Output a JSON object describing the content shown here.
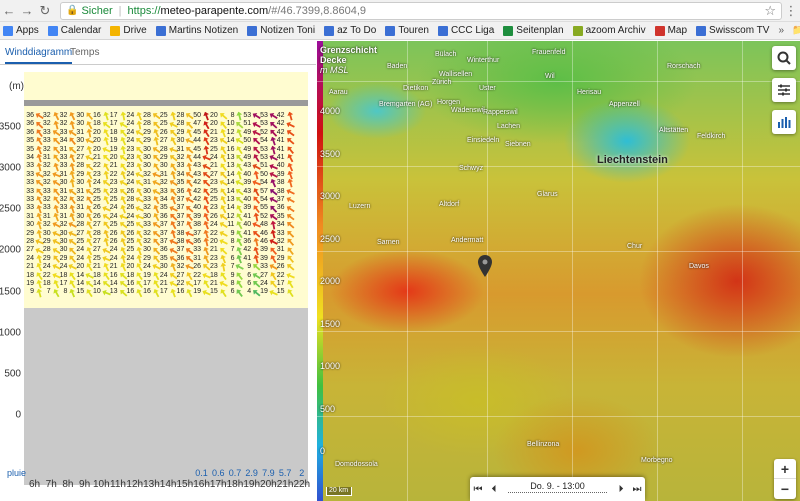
{
  "browser": {
    "secure_label": "Sicher",
    "url_scheme": "https://",
    "url_host": "meteo-parapente.com",
    "url_rest": "/#/46.7399,8.8604,9"
  },
  "bookmarks": [
    {
      "label": "Apps",
      "color": "#4285f4"
    },
    {
      "label": "Calendar",
      "color": "#4285f4"
    },
    {
      "label": "Drive",
      "color": "#f4b400"
    },
    {
      "label": "Martins Notizen",
      "color": "#3b6fd4"
    },
    {
      "label": "Notizen Toni",
      "color": "#3b6fd4"
    },
    {
      "label": "az To Do",
      "color": "#3b6fd4"
    },
    {
      "label": "Touren",
      "color": "#3b6fd4"
    },
    {
      "label": "CCC Liga",
      "color": "#3b6fd4"
    },
    {
      "label": "Seitenplan",
      "color": "#1e8e3e"
    },
    {
      "label": "azoom Archiv",
      "color": "#88aa22"
    },
    {
      "label": "Map",
      "color": "#d0342c"
    },
    {
      "label": "Swisscom TV",
      "color": "#3b6fd4"
    }
  ],
  "bookmarks_more": "»",
  "bookmarks_other": "Andere Lesezeichen",
  "tabs": {
    "active": "Winddiagramm",
    "inactive": "Temps"
  },
  "diagram": {
    "unit": "(m)",
    "yticks": [
      "3500",
      "3000",
      "2500",
      "2000",
      "1500",
      "1000",
      "500",
      "0"
    ],
    "hours": [
      "6h",
      "7h",
      "8h",
      "9h",
      "10h",
      "11h",
      "12h",
      "13h",
      "14h",
      "15h",
      "16h",
      "17h",
      "18h",
      "19h",
      "20h",
      "21h",
      "22h"
    ],
    "precip_label": "pluie",
    "precip": [
      "",
      "",
      "",
      "",
      "",
      "",
      "",
      "",
      "",
      "",
      "0.1",
      "0.6",
      "0.7",
      "2.9",
      "7.9",
      "5.7",
      "2"
    ],
    "columns": [
      {
        "values": [
          "36",
          "36",
          "36",
          "35",
          "35",
          "34",
          "33",
          "33",
          "33",
          "33",
          "33",
          "33",
          "31",
          "30",
          "29",
          "28",
          "27",
          "24",
          "21",
          "18",
          "19",
          "9"
        ],
        "colors": [
          "#f07a20",
          "#f07a20",
          "#f07a20",
          "#f08a20",
          "#f08a20",
          "#f08a20",
          "#f09a20",
          "#f09a20",
          "#f09a20",
          "#f09a20",
          "#f09a20",
          "#f09a20",
          "#f0a820",
          "#f0b020",
          "#f0b820",
          "#f0c020",
          "#f0c820",
          "#f0d020",
          "#f0dc20",
          "#e8e020",
          "#e8e020",
          "#d8e020"
        ]
      },
      {
        "values": [
          "32",
          "32",
          "33",
          "33",
          "32",
          "31",
          "32",
          "32",
          "32",
          "33",
          "32",
          "33",
          "31",
          "32",
          "30",
          "29",
          "28",
          "29",
          "24",
          "22",
          "18",
          "7"
        ],
        "colors": [
          "#f09a20",
          "#f09a20",
          "#f09a20",
          "#f09a20",
          "#f09a20",
          "#f0a820",
          "#f09a20",
          "#f09a20",
          "#f09a20",
          "#f09a20",
          "#f09a20",
          "#f09a20",
          "#f0a820",
          "#f09a20",
          "#f0b820",
          "#f0c020",
          "#f0c820",
          "#f0c020",
          "#f0d020",
          "#f0dc20",
          "#e8e020",
          "#c8e020"
        ]
      },
      {
        "values": [
          "32",
          "32",
          "33",
          "34",
          "31",
          "33",
          "33",
          "31",
          "30",
          "31",
          "32",
          "33",
          "31",
          "32",
          "30",
          "30",
          "30",
          "29",
          "24",
          "18",
          "17",
          "8"
        ],
        "colors": [
          "#f09a20",
          "#f09a20",
          "#f09a20",
          "#f08a20",
          "#f0a820",
          "#f09a20",
          "#f09a20",
          "#f0a820",
          "#f0b020",
          "#f0a820",
          "#f09a20",
          "#f09a20",
          "#f0a820",
          "#f09a20",
          "#f0b820",
          "#f0b820",
          "#f0b820",
          "#f0c020",
          "#f0d020",
          "#e8e020",
          "#e8e020",
          "#c8e020"
        ]
      },
      {
        "values": [
          "30",
          "30",
          "31",
          "30",
          "27",
          "27",
          "28",
          "29",
          "30",
          "31",
          "32",
          "31",
          "30",
          "28",
          "27",
          "25",
          "24",
          "24",
          "20",
          "14",
          "14",
          "15"
        ],
        "colors": [
          "#f0b020",
          "#f0b020",
          "#f0a820",
          "#f0b020",
          "#f0c820",
          "#f0c820",
          "#f0c020",
          "#f0c020",
          "#f0b020",
          "#f0a820",
          "#f09a20",
          "#f0a820",
          "#f0b020",
          "#f0c020",
          "#f0c820",
          "#f0d020",
          "#f0d020",
          "#f0d020",
          "#f0dc20",
          "#e0e020",
          "#e0e020",
          "#e0e020"
        ]
      },
      {
        "values": [
          "16",
          "18",
          "20",
          "20",
          "20",
          "21",
          "22",
          "23",
          "24",
          "25",
          "25",
          "26",
          "26",
          "27",
          "28",
          "27",
          "27",
          "25",
          "21",
          "18",
          "14",
          "10"
        ],
        "colors": [
          "#e0e020",
          "#e8e020",
          "#f0dc20",
          "#f0dc20",
          "#f0dc20",
          "#f0dc20",
          "#f0d020",
          "#f0d020",
          "#f0d020",
          "#f0d020",
          "#f0d020",
          "#f0c820",
          "#f0c820",
          "#f0c820",
          "#f0c020",
          "#f0c820",
          "#f0c820",
          "#f0d020",
          "#f0dc20",
          "#e8e020",
          "#e0e020",
          "#c8e020"
        ]
      },
      {
        "values": [
          "17",
          "17",
          "18",
          "19",
          "19",
          "20",
          "21",
          "22",
          "23",
          "23",
          "25",
          "24",
          "24",
          "25",
          "26",
          "26",
          "24",
          "24",
          "21",
          "16",
          "14",
          "13"
        ],
        "colors": [
          "#e8e020",
          "#e8e020",
          "#e8e020",
          "#e8e020",
          "#e8e020",
          "#f0dc20",
          "#f0dc20",
          "#f0d020",
          "#f0d020",
          "#f0d020",
          "#f0d020",
          "#f0d020",
          "#f0d020",
          "#f0d020",
          "#f0c820",
          "#f0c820",
          "#f0d020",
          "#f0d020",
          "#f0dc20",
          "#e0e020",
          "#e0e020",
          "#d8e020"
        ]
      },
      {
        "values": [
          "24",
          "24",
          "24",
          "24",
          "23",
          "23",
          "23",
          "24",
          "24",
          "26",
          "28",
          "26",
          "24",
          "25",
          "26",
          "25",
          "25",
          "24",
          "20",
          "18",
          "16",
          "16"
        ],
        "colors": [
          "#f0d020",
          "#f0d020",
          "#f0d020",
          "#f0d020",
          "#f0d020",
          "#f0d020",
          "#f0d020",
          "#f0d020",
          "#f0d020",
          "#f0c820",
          "#f0c020",
          "#f0c820",
          "#f0d020",
          "#f0d020",
          "#f0c820",
          "#f0d020",
          "#f0d020",
          "#f0d020",
          "#f0dc20",
          "#e8e020",
          "#e0e020",
          "#e0e020"
        ]
      },
      {
        "values": [
          "28",
          "28",
          "29",
          "29",
          "30",
          "30",
          "30",
          "32",
          "31",
          "30",
          "33",
          "32",
          "30",
          "33",
          "32",
          "32",
          "30",
          "29",
          "24",
          "19",
          "17",
          "16"
        ],
        "colors": [
          "#f0c020",
          "#f0c020",
          "#f0c020",
          "#f0c020",
          "#f0b020",
          "#f0b020",
          "#f0b020",
          "#f09a20",
          "#f0a820",
          "#f0b020",
          "#f09a20",
          "#f09a20",
          "#f0b020",
          "#f09a20",
          "#f09a20",
          "#f09a20",
          "#f0b020",
          "#f0c020",
          "#f0d020",
          "#e8e020",
          "#e8e020",
          "#e0e020"
        ]
      },
      {
        "values": [
          "25",
          "25",
          "26",
          "27",
          "28",
          "29",
          "30",
          "31",
          "32",
          "33",
          "34",
          "35",
          "36",
          "37",
          "37",
          "37",
          "36",
          "35",
          "30",
          "24",
          "21",
          "17"
        ],
        "colors": [
          "#f0d020",
          "#f0d020",
          "#f0c820",
          "#f0c820",
          "#f0c020",
          "#f0c020",
          "#f0b020",
          "#f0a820",
          "#f09a20",
          "#f09a20",
          "#f08a20",
          "#f08a20",
          "#f07a20",
          "#f07a20",
          "#f07a20",
          "#f07a20",
          "#f07a20",
          "#f08a20",
          "#f0b020",
          "#f0d020",
          "#f0dc20",
          "#e8e020"
        ]
      },
      {
        "values": [
          "28",
          "28",
          "29",
          "30",
          "31",
          "32",
          "33",
          "34",
          "35",
          "36",
          "37",
          "37",
          "37",
          "37",
          "38",
          "38",
          "37",
          "36",
          "32",
          "27",
          "22",
          "16"
        ],
        "colors": [
          "#f0c020",
          "#f0c020",
          "#f0c020",
          "#f0b020",
          "#f0a820",
          "#f09a20",
          "#f09a20",
          "#f08a20",
          "#f08a20",
          "#f07a20",
          "#f07a20",
          "#f07a20",
          "#f07a20",
          "#f07a20",
          "#f06a20",
          "#f06a20",
          "#f07a20",
          "#f07a20",
          "#f09a20",
          "#f0c820",
          "#f0d020",
          "#e0e020"
        ]
      },
      {
        "values": [
          "50",
          "47",
          "45",
          "44",
          "45",
          "44",
          "43",
          "43",
          "42",
          "42",
          "42",
          "40",
          "39",
          "38",
          "37",
          "36",
          "33",
          "31",
          "26",
          "22",
          "17",
          "19"
        ],
        "colors": [
          "#c01818",
          "#d02018",
          "#d83018",
          "#e03a18",
          "#d83018",
          "#e03a18",
          "#e04a18",
          "#e04a18",
          "#e85018",
          "#e85018",
          "#e85018",
          "#f05a20",
          "#f06020",
          "#f06a20",
          "#f07a20",
          "#f07a20",
          "#f09a20",
          "#f0a820",
          "#f0c820",
          "#f0dc20",
          "#e8e020",
          "#e8e020"
        ]
      },
      {
        "values": [
          "20",
          "20",
          "21",
          "23",
          "25",
          "24",
          "21",
          "27",
          "23",
          "25",
          "25",
          "23",
          "26",
          "24",
          "22",
          "20",
          "21",
          "23",
          "23",
          "18",
          "21",
          "15"
        ],
        "colors": [
          "#f0dc20",
          "#f0dc20",
          "#f0dc20",
          "#f0d020",
          "#f0d020",
          "#f0d020",
          "#f0dc20",
          "#f0c820",
          "#f0d020",
          "#f0d020",
          "#f0d020",
          "#f0d020",
          "#f0c820",
          "#f0d020",
          "#f0d020",
          "#f0dc20",
          "#f0dc20",
          "#f0d020",
          "#f0d020",
          "#e8e020",
          "#f0dc20",
          "#e0e020"
        ]
      },
      {
        "values": [
          "8",
          "10",
          "12",
          "14",
          "16",
          "13",
          "13",
          "14",
          "14",
          "14",
          "13",
          "14",
          "12",
          "11",
          "9",
          "8",
          "7",
          "6",
          "7",
          "9",
          "8",
          "6"
        ],
        "colors": [
          "#90d840",
          "#a8d840",
          "#c0dc30",
          "#d8e020",
          "#e0e020",
          "#c8dc30",
          "#c8dc30",
          "#d8e020",
          "#d8e020",
          "#d8e020",
          "#c8dc30",
          "#d8e020",
          "#c0dc30",
          "#b0d840",
          "#98d840",
          "#90d840",
          "#80d050",
          "#70c850",
          "#80d050",
          "#98d840",
          "#90d840",
          "#70c850"
        ]
      },
      {
        "values": [
          "53",
          "51",
          "49",
          "50",
          "49",
          "49",
          "43",
          "40",
          "39",
          "43",
          "40",
          "39",
          "41",
          "40",
          "41",
          "36",
          "42",
          "41",
          "9",
          "6",
          "6",
          "4"
        ],
        "colors": [
          "#a01060",
          "#b01050",
          "#b81848",
          "#b01050",
          "#b81848",
          "#b81848",
          "#e04a18",
          "#f05a20",
          "#f06020",
          "#e04a18",
          "#f05a20",
          "#f06020",
          "#e85018",
          "#f05a20",
          "#e85018",
          "#f07a20",
          "#e85018",
          "#e85018",
          "#98d840",
          "#70c850",
          "#70c850",
          "#50b860"
        ]
      },
      {
        "values": [
          "53",
          "53",
          "52",
          "54",
          "53",
          "53",
          "51",
          "50",
          "54",
          "57",
          "54",
          "55",
          "52",
          "48",
          "46",
          "46",
          "39",
          "39",
          "33",
          "27",
          "24",
          "19"
        ],
        "colors": [
          "#a01060",
          "#a01060",
          "#a81058",
          "#981068",
          "#a01060",
          "#a01060",
          "#b01050",
          "#b81848",
          "#981068",
          "#881070",
          "#981068",
          "#901068",
          "#a81058",
          "#c01840",
          "#d02018",
          "#d02018",
          "#f06020",
          "#f06020",
          "#f09a20",
          "#f0c820",
          "#f0d020",
          "#e8e020"
        ]
      },
      {
        "values": [
          "42",
          "42",
          "42",
          "41",
          "41",
          "41",
          "40",
          "39",
          "38",
          "38",
          "37",
          "36",
          "35",
          "34",
          "33",
          "32",
          "31",
          "29",
          "26",
          "22",
          "17",
          "15"
        ],
        "colors": [
          "#e85018",
          "#e85018",
          "#e85018",
          "#e85018",
          "#e85018",
          "#e85018",
          "#f05a20",
          "#f06020",
          "#f06a20",
          "#f06a20",
          "#f07a20",
          "#f07a20",
          "#f08a20",
          "#f08a20",
          "#f09a20",
          "#f09a20",
          "#f0a820",
          "#f0c020",
          "#f0c820",
          "#f0dc20",
          "#e8e020",
          "#e0e020"
        ]
      }
    ]
  },
  "map": {
    "legend_title": "Grenzschicht Decke",
    "legend_sub": "m MSL",
    "legend_ticks": [
      "4000",
      "3500",
      "3000",
      "2500",
      "2000",
      "1500",
      "1000",
      "500",
      "0"
    ],
    "places": [
      {
        "name": "Bülach",
        "x": 108,
        "y": 10
      },
      {
        "name": "Winterthur",
        "x": 140,
        "y": 16
      },
      {
        "name": "Frauenfeld",
        "x": 205,
        "y": 8
      },
      {
        "name": "Wil",
        "x": 218,
        "y": 32
      },
      {
        "name": "Baden",
        "x": 60,
        "y": 22
      },
      {
        "name": "Uster",
        "x": 152,
        "y": 44
      },
      {
        "name": "Zürich",
        "x": 105,
        "y": 38
      },
      {
        "name": "Wallisellen",
        "x": 112,
        "y": 30
      },
      {
        "name": "Aarau",
        "x": 2,
        "y": 48
      },
      {
        "name": "Dietikon",
        "x": 76,
        "y": 44
      },
      {
        "name": "Horgen",
        "x": 110,
        "y": 58
      },
      {
        "name": "Bremgarten (AG)",
        "x": 52,
        "y": 60
      },
      {
        "name": "Wädenswil",
        "x": 124,
        "y": 66
      },
      {
        "name": "Rapperswil",
        "x": 156,
        "y": 68
      },
      {
        "name": "Lachen",
        "x": 170,
        "y": 82
      },
      {
        "name": "Appenzell",
        "x": 282,
        "y": 60
      },
      {
        "name": "Herisau",
        "x": 250,
        "y": 48
      },
      {
        "name": "Rorschach",
        "x": 340,
        "y": 22
      },
      {
        "name": "Altstätten",
        "x": 332,
        "y": 86
      },
      {
        "name": "Feldkirch",
        "x": 370,
        "y": 92
      },
      {
        "name": "Einsiedeln",
        "x": 140,
        "y": 96
      },
      {
        "name": "Siebnen",
        "x": 178,
        "y": 100
      },
      {
        "name": "Luzern",
        "x": 22,
        "y": 162
      },
      {
        "name": "Schwyz",
        "x": 132,
        "y": 124
      },
      {
        "name": "Glarus",
        "x": 210,
        "y": 150
      },
      {
        "name": "Altdorf",
        "x": 112,
        "y": 160
      },
      {
        "name": "Sarnen",
        "x": 50,
        "y": 198
      },
      {
        "name": "Chur",
        "x": 300,
        "y": 202
      },
      {
        "name": "Andermatt",
        "x": 124,
        "y": 196
      },
      {
        "name": "Davos",
        "x": 362,
        "y": 222
      },
      {
        "name": "Bellinzona",
        "x": 200,
        "y": 400
      },
      {
        "name": "Domodossola",
        "x": 8,
        "y": 420
      },
      {
        "name": "Morbegno",
        "x": 314,
        "y": 416
      }
    ],
    "big_label": "Liechtenstein",
    "scale_label": "20 km",
    "timebar_date": "Do. 9. - 13:00",
    "controls": [
      "search-icon",
      "sliders-icon",
      "chart-icon"
    ],
    "zoom_in": "+",
    "zoom_out": "−"
  }
}
